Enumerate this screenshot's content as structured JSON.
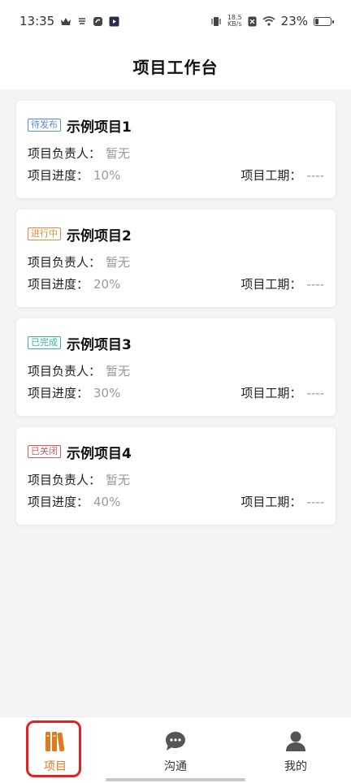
{
  "status_bar": {
    "time": "13:35",
    "net_speed_value": "18.5",
    "net_speed_unit": "KB/s",
    "battery": "23%",
    "icons": [
      "crown-icon",
      "app-icon",
      "app-icon",
      "play-icon",
      "vibrate-icon",
      "sim-icon",
      "wifi-icon",
      "battery-icon"
    ]
  },
  "header": {
    "title": "项目工作台"
  },
  "projects": [
    {
      "status": "待发布",
      "status_color": "#5b8cc7",
      "name": "示例项目1",
      "owner_label": "项目负责人：",
      "owner": "暂无",
      "progress_label": "项目进度：",
      "progress": "10%",
      "period_label": "项目工期：",
      "period": "----"
    },
    {
      "status": "进行中",
      "status_color": "#e08a3a",
      "name": "示例项目2",
      "owner_label": "项目负责人：",
      "owner": "暂无",
      "progress_label": "项目进度：",
      "progress": "20%",
      "period_label": "项目工期：",
      "period": "----"
    },
    {
      "status": "已完成",
      "status_color": "#3bb39a",
      "name": "示例项目3",
      "owner_label": "项目负责人：",
      "owner": "暂无",
      "progress_label": "项目进度：",
      "progress": "30%",
      "period_label": "项目工期：",
      "period": "----"
    },
    {
      "status": "已关闭",
      "status_color": "#d05a5a",
      "name": "示例项目4",
      "owner_label": "项目负责人：",
      "owner": "暂无",
      "progress_label": "项目进度：",
      "progress": "40%",
      "period_label": "项目工期：",
      "period": "----"
    }
  ],
  "tabbar": {
    "items": [
      {
        "label": "项目",
        "icon": "books-icon",
        "active": true
      },
      {
        "label": "沟通",
        "icon": "chat-bubble-icon",
        "active": false
      },
      {
        "label": "我的",
        "icon": "user-icon",
        "active": false
      }
    ],
    "accent": "#e07a1f"
  }
}
